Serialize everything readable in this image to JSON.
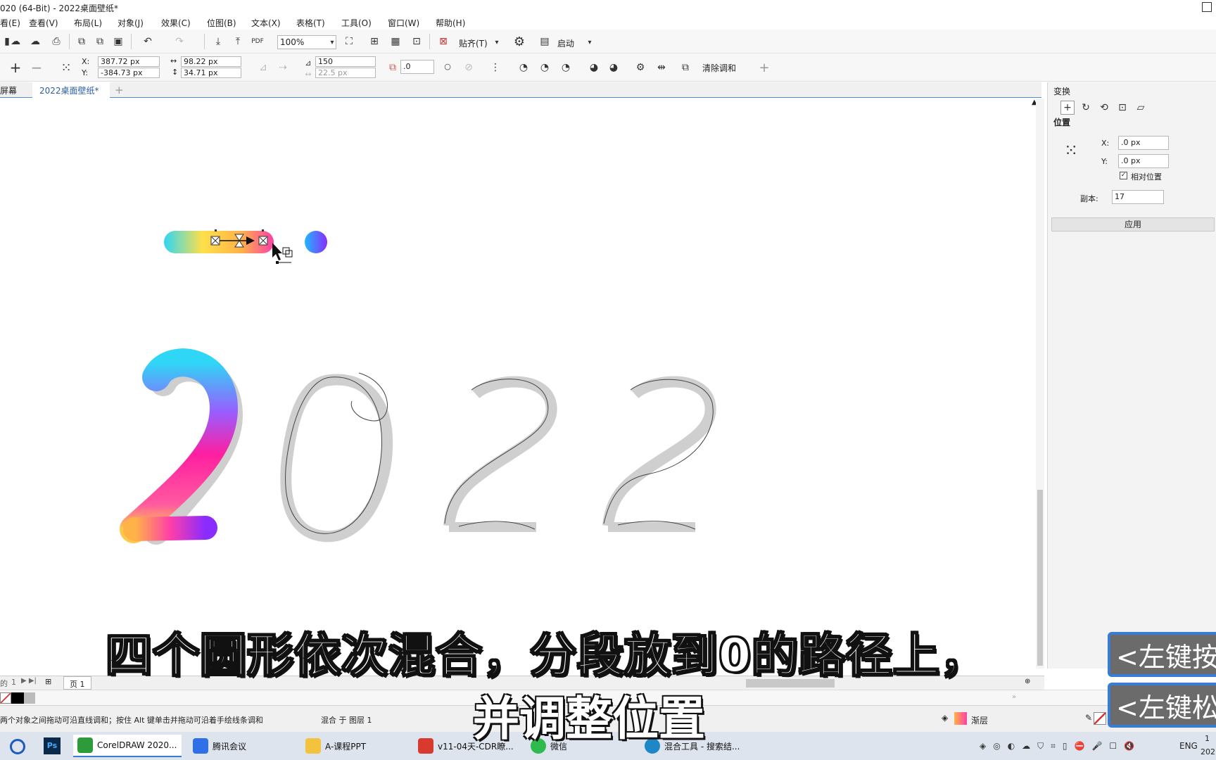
{
  "window": {
    "title": "020 (64-Bit) - 2022桌面壁纸*"
  },
  "menu": [
    "看(E)",
    "查看(V)",
    "布局(L)",
    "对象(J)",
    "效果(C)",
    "位图(B)",
    "文本(X)",
    "表格(T)",
    "工具(O)",
    "窗口(W)",
    "帮助(H)"
  ],
  "toolbar": {
    "zoom": "100%",
    "snap_label": "贴齐(T)",
    "launch_label": "启动"
  },
  "propbar": {
    "x_label": "X:",
    "x_value": "387.72 px",
    "y_label": "Y:",
    "y_value": "-384.73 px",
    "w_value": "98.22 px",
    "h_value": "34.71 px",
    "steps_value": "150",
    "spacing_value": "22.5 px",
    "angle_value": ".0",
    "clear_blend_label": "清除调和"
  },
  "doc_tabs": [
    "屏幕",
    "2022桌面壁纸*"
  ],
  "transform_panel": {
    "title": "变换",
    "position_heading": "位置",
    "x_label": "X:",
    "x_value": ".0 px",
    "y_label": "Y:",
    "y_value": ".0 px",
    "relative_label": "相对位置",
    "copies_label": "副本:",
    "copies_value": "17",
    "apply_label": "应用"
  },
  "pagebar": {
    "page_count": "1",
    "page_label": "页 1",
    "left_text": "的"
  },
  "status": {
    "hint": "两个对象之间拖动可沿直线调和；按住 Alt 键单击并拖动可沿着手绘线条调和",
    "layer": "混合 于 图层 1",
    "fill_label": "渐层"
  },
  "taskbar": {
    "items": [
      "CorelDRAW 2020...",
      "腾讯会议",
      "A-课程PPT",
      "v11-04天-CDR瞭...",
      "微信",
      "混合工具 - 搜索结..."
    ],
    "lang": "ENG",
    "clock_top": "1",
    "clock_bottom": "202"
  },
  "canvas_text": {
    "numerals": "2022"
  },
  "subtitles": {
    "line1": "四个圆形依次混合，分段放到0的路径上，",
    "line2": "并调整位置"
  },
  "key_overlay": {
    "top": "<左键按",
    "bottom": "<左键松"
  },
  "colors": {
    "accent": "#3a7bd5",
    "gradient_cyan": "#2fd6f5",
    "gradient_magenta": "#ff1fa0",
    "gradient_yellow": "#ffd24a",
    "gradient_purple": "#7a2bff"
  }
}
